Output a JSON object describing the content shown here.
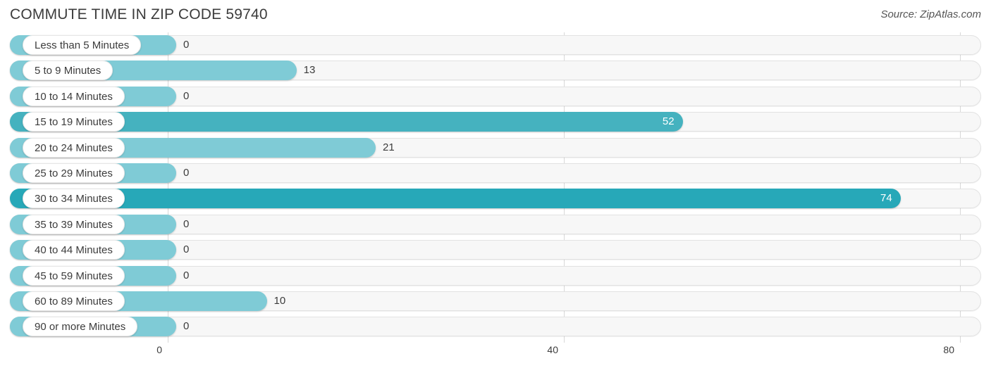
{
  "header": {
    "title": "COMMUTE TIME IN ZIP CODE 59740",
    "source": "Source: ZipAtlas.com"
  },
  "axis": {
    "ticks": [
      "0",
      "40",
      "80"
    ],
    "tick_values": [
      0,
      40,
      80
    ]
  },
  "colors": {
    "bar_low": "#7fcbd6",
    "bar_mid": "#45b2bf",
    "bar_high": "#27a8b8",
    "track_bg": "#f7f7f7",
    "track_border": "#e2e2e2",
    "gridline": "#d8d8d8",
    "text": "#3c3c3c",
    "value_inside": "#ffffff"
  },
  "chart_data": {
    "type": "bar",
    "orientation": "horizontal",
    "title": "COMMUTE TIME IN ZIP CODE 59740",
    "xlabel": "",
    "ylabel": "",
    "xlim": [
      0,
      80
    ],
    "grid": true,
    "legend": null,
    "categories": [
      "Less than 5 Minutes",
      "5 to 9 Minutes",
      "10 to 14 Minutes",
      "15 to 19 Minutes",
      "20 to 24 Minutes",
      "25 to 29 Minutes",
      "30 to 34 Minutes",
      "35 to 39 Minutes",
      "40 to 44 Minutes",
      "45 to 59 Minutes",
      "60 to 89 Minutes",
      "90 or more Minutes"
    ],
    "values": [
      0,
      13,
      0,
      52,
      21,
      0,
      74,
      0,
      0,
      0,
      10,
      0
    ],
    "value_labels": [
      "0",
      "13",
      "0",
      "52",
      "21",
      "0",
      "74",
      "0",
      "0",
      "0",
      "10",
      "0"
    ]
  }
}
